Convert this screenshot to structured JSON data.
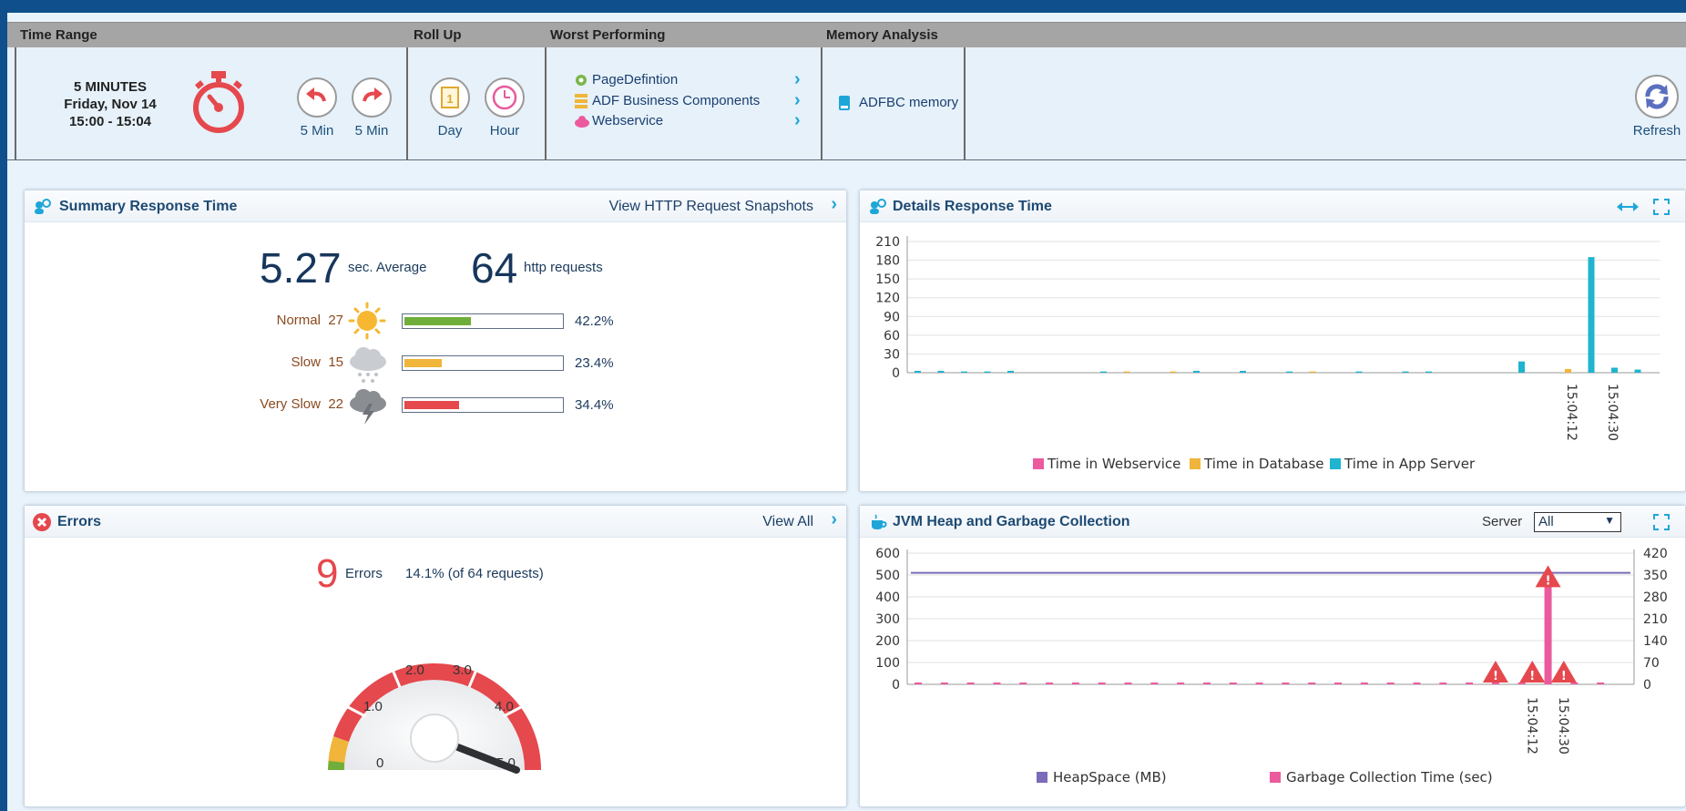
{
  "toolbar": {
    "headers": {
      "time_range": "Time Range",
      "roll_up": "Roll Up",
      "worst": "Worst Performing",
      "memory": "Memory Analysis"
    },
    "time": {
      "line1": "5 MINUTES",
      "line2": "Friday, Nov 14",
      "line3": "15:00 - 15:04"
    },
    "back_label": "5 Min",
    "forward_label": "5 Min",
    "day_label": "Day",
    "hour_label": "Hour",
    "day_icon_text": "1",
    "worst_items": [
      "PageDefintion",
      "ADF Business Components",
      "Webservice"
    ],
    "memory_item": "ADFBC memory",
    "refresh_label": "Refresh"
  },
  "summary": {
    "title": "Summary Response Time",
    "link": "View HTTP Request Snapshots",
    "avg_value": "5.27",
    "avg_label": "sec. Average",
    "req_value": "64",
    "req_label": "http requests",
    "rows": [
      {
        "label": "Normal",
        "count": "27",
        "pct_text": "42.2%",
        "fraction": 0.422,
        "color": "#6fae3a"
      },
      {
        "label": "Slow",
        "count": "15",
        "pct_text": "23.4%",
        "fraction": 0.234,
        "color": "#f0b53a"
      },
      {
        "label": "Very Slow",
        "count": "22",
        "pct_text": "34.4%",
        "fraction": 0.344,
        "color": "#e5484d"
      }
    ]
  },
  "details": {
    "title": "Details Response Time",
    "legend": [
      "Time in Webservice",
      "Time in Database",
      "Time in App Server"
    ]
  },
  "errors": {
    "title": "Errors",
    "link": "View All",
    "count": "9",
    "count_label": "Errors",
    "pct_text": "14.1% (of 64 requests)",
    "gauge_ticks": [
      "0",
      "1.0",
      "2.0",
      "3.0",
      "4.0",
      "5.0"
    ]
  },
  "jvm": {
    "title": "JVM Heap and Garbage Collection",
    "server_label": "Server",
    "server_value": "All",
    "legend": [
      "HeapSpace (MB)",
      "Garbage Collection Time (sec)"
    ]
  },
  "colors": {
    "accent": "#1fa6d8",
    "webservice": "#ec5a9e",
    "database": "#f0b53a",
    "appserver": "#1fb4cf",
    "heap": "#7b6bb8",
    "gc": "#ec5a9e",
    "error": "#e5484d"
  },
  "chart_data": [
    {
      "type": "bar",
      "name": "Details Response Time",
      "ylim": [
        0,
        210
      ],
      "yticks": [
        0,
        30,
        60,
        90,
        120,
        150,
        180,
        210
      ],
      "xticks": [
        "15:04:12",
        "15:04:30"
      ],
      "series": [
        {
          "name": "Time in Webservice",
          "values": [
            0,
            0,
            0,
            0,
            0,
            0,
            0,
            0,
            0,
            0,
            0,
            0,
            0,
            0,
            0,
            0,
            0,
            0,
            0,
            0,
            0,
            0,
            0,
            0,
            0,
            0,
            0,
            0,
            0,
            0,
            0,
            0
          ]
        },
        {
          "name": "Time in Database",
          "values": [
            0,
            0,
            0,
            0,
            0,
            0,
            0,
            0,
            0,
            2,
            0,
            2,
            0,
            0,
            0,
            0,
            0,
            2,
            0,
            0,
            0,
            0,
            0,
            0,
            0,
            0,
            0,
            0,
            6,
            0,
            0,
            0
          ]
        },
        {
          "name": "Time in App Server",
          "values": [
            3,
            3,
            2,
            2,
            3,
            0,
            0,
            0,
            2,
            0,
            0,
            0,
            3,
            0,
            3,
            0,
            2,
            0,
            0,
            2,
            0,
            2,
            2,
            0,
            0,
            0,
            18,
            0,
            0,
            185,
            8,
            5
          ]
        }
      ]
    },
    {
      "type": "line",
      "name": "JVM Heap and Garbage Collection",
      "ylim": [
        0,
        600
      ],
      "y2lim": [
        0,
        420
      ],
      "yticks": [
        0,
        100,
        200,
        300,
        400,
        500,
        600
      ],
      "y2ticks": [
        0,
        70,
        140,
        210,
        280,
        350,
        420
      ],
      "xticks": [
        "15:04:12",
        "15:04:30"
      ],
      "series": [
        {
          "name": "HeapSpace (MB)",
          "axis": "left",
          "values": [
            510,
            510
          ]
        },
        {
          "name": "Garbage Collection Time (sec)",
          "axis": "right",
          "values": [
            0,
            0,
            0,
            0,
            0,
            0,
            0,
            0,
            0,
            0,
            0,
            0,
            0,
            0,
            0,
            0,
            0,
            0,
            0,
            0,
            0,
            0,
            0,
            0,
            340,
            0,
            0
          ]
        }
      ]
    }
  ]
}
